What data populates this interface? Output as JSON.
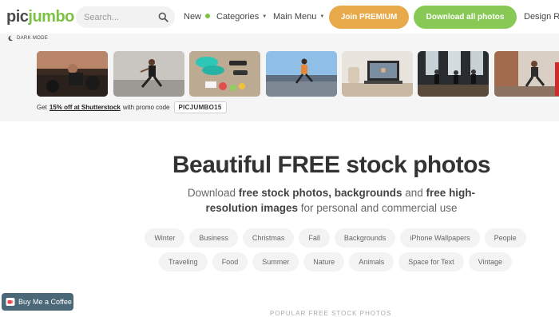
{
  "header": {
    "logo_main": "pic",
    "logo_accent": "jumbo",
    "search_placeholder": "Search...",
    "nav": {
      "new_label": "New",
      "categories_label": "Categories",
      "main_menu_label": "Main Menu",
      "design_label": "Design Re"
    },
    "buttons": {
      "premium_label": "Join PREMIUM",
      "download_label": "Download all photos"
    }
  },
  "colors": {
    "brand_green": "#7cc242",
    "premium_orange": "#e8a94a",
    "download_green": "#88c854"
  },
  "dark_mode_label": "DARK MODE",
  "promo": {
    "prefix": "Get",
    "link": "15% off at Shutterstock",
    "middle": "with promo code",
    "code": "PICJUMBO15"
  },
  "thumbnails": [
    {
      "name": "gym-dumbbells-photo"
    },
    {
      "name": "woman-running-photo"
    },
    {
      "name": "sneakers-fitness-gear-photo"
    },
    {
      "name": "runner-boardwalk-photo"
    },
    {
      "name": "laptop-workout-photo"
    },
    {
      "name": "gym-class-photo"
    },
    {
      "name": "home-workout-photo"
    }
  ],
  "hero": {
    "title": "Beautiful FREE stock photos",
    "sub_1": "Download ",
    "sub_2": "free stock photos, backgrounds",
    "sub_3": " and ",
    "sub_4": "free high-resolution images",
    "sub_5": " for personal and commercial use"
  },
  "tags_row1": [
    "Winter",
    "Business",
    "Christmas",
    "Fall",
    "Backgrounds",
    "iPhone Wallpapers",
    "People"
  ],
  "tags_row2": [
    "Traveling",
    "Food",
    "Summer",
    "Nature",
    "Animals",
    "Space for Text",
    "Vintage"
  ],
  "coffee_button": "Buy Me a Coffee",
  "bottom_heading": "POPULAR FREE STOCK PHOTOS"
}
